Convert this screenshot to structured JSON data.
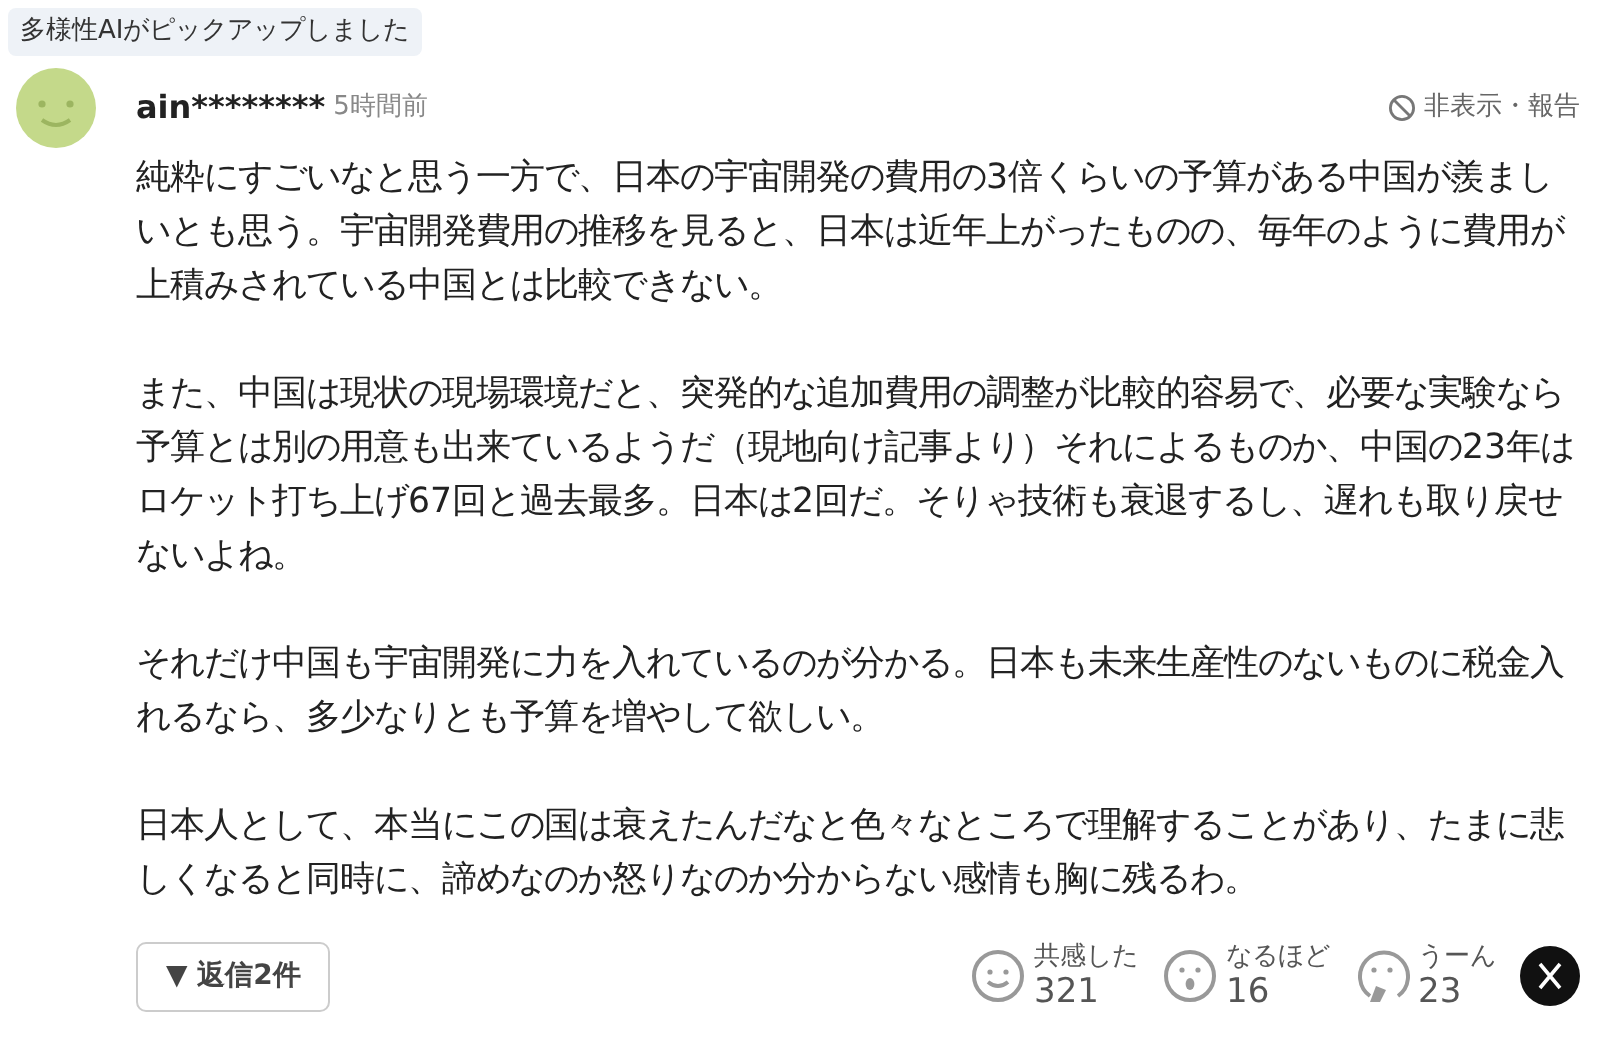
{
  "badge": "多様性AIがピックアップしました",
  "comment": {
    "user": "ain********",
    "time": "5時間前",
    "report": "非表示・報告",
    "paragraphs": [
      "純粋にすごいなと思う一方で、日本の宇宙開発の費用の3倍くらいの予算がある中国が羨ましいとも思う。宇宙開発費用の推移を見ると、日本は近年上がったものの、毎年のように費用が上積みされている中国とは比較できない。",
      "また、中国は現状の現場環境だと、突発的な追加費用の調整が比較的容易で、必要な実験なら予算とは別の用意も出来ているようだ（現地向け記事より）それによるものか、中国の23年はロケット打ち上げ67回と過去最多。日本は2回だ。そりゃ技術も衰退するし、遅れも取り戻せないよね。",
      "それだけ中国も宇宙開発に力を入れているのが分かる。日本も未来生産性のないものに税金入れるなら、多少なりとも予算を増やして欲しい。",
      "日本人として、本当にこの国は衰えたんだなと色々なところで理解することがあり、たまに悲しくなると同時に、諦めなのか怒りなのか分からない感情も胸に残るわ。"
    ]
  },
  "replies": {
    "arrow": "▼",
    "label": "返信2件"
  },
  "reactions": [
    {
      "kind": "smile",
      "label": "共感した",
      "count": "321"
    },
    {
      "kind": "surprise",
      "label": "なるほど",
      "count": "16"
    },
    {
      "kind": "think",
      "label": "うーん",
      "count": "23"
    }
  ]
}
